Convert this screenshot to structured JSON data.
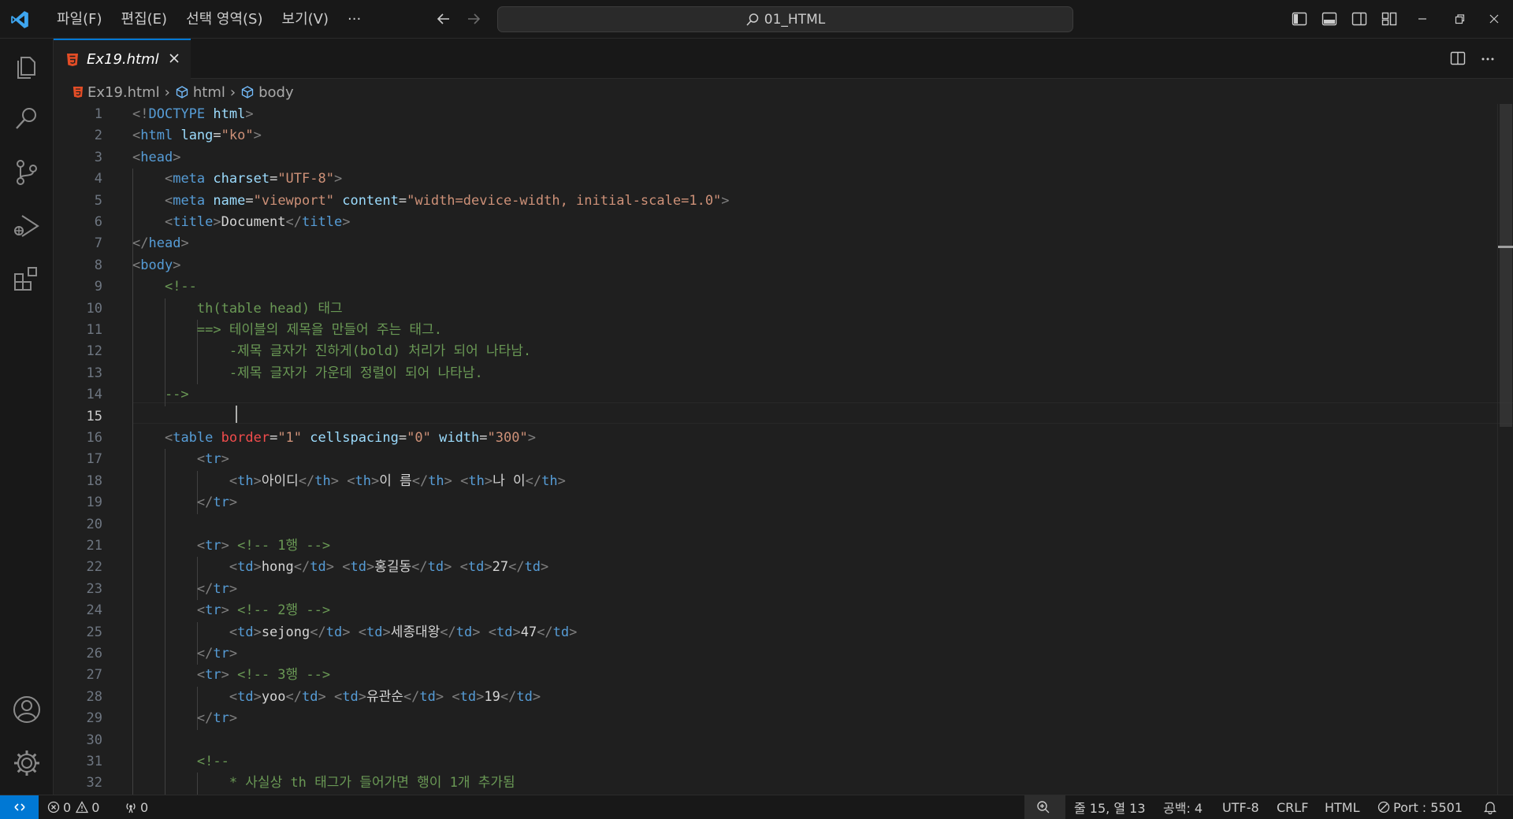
{
  "menus": [
    "파일(F)",
    "편집(E)",
    "선택 영역(S)",
    "보기(V)",
    "···"
  ],
  "command_center": {
    "label": "01_HTML"
  },
  "tab": {
    "name": "Ex19.html"
  },
  "breadcrumb": {
    "file": "Ex19.html",
    "html": "html",
    "body": "body"
  },
  "editor": {
    "active_line": 15,
    "lines": [
      [
        [
          "pun",
          "<!"
        ],
        [
          "tag",
          "DOCTYPE"
        ],
        [
          "txt",
          " "
        ],
        [
          "attr",
          "html"
        ],
        [
          "pun",
          ">"
        ]
      ],
      [
        [
          "pun",
          "<"
        ],
        [
          "tag",
          "html"
        ],
        [
          "txt",
          " "
        ],
        [
          "attr",
          "lang"
        ],
        [
          "txt",
          "="
        ],
        [
          "str",
          "\"ko\""
        ],
        [
          "pun",
          ">"
        ]
      ],
      [
        [
          "pun",
          "<"
        ],
        [
          "tag",
          "head"
        ],
        [
          "pun",
          ">"
        ]
      ],
      [
        [
          "txt",
          "    "
        ],
        [
          "pun",
          "<"
        ],
        [
          "tag",
          "meta"
        ],
        [
          "txt",
          " "
        ],
        [
          "attr",
          "charset"
        ],
        [
          "txt",
          "="
        ],
        [
          "str",
          "\"UTF-8\""
        ],
        [
          "pun",
          ">"
        ]
      ],
      [
        [
          "txt",
          "    "
        ],
        [
          "pun",
          "<"
        ],
        [
          "tag",
          "meta"
        ],
        [
          "txt",
          " "
        ],
        [
          "attr",
          "name"
        ],
        [
          "txt",
          "="
        ],
        [
          "str",
          "\"viewport\""
        ],
        [
          "txt",
          " "
        ],
        [
          "attr",
          "content"
        ],
        [
          "txt",
          "="
        ],
        [
          "str",
          "\"width=device-width, initial-scale=1.0\""
        ],
        [
          "pun",
          ">"
        ]
      ],
      [
        [
          "txt",
          "    "
        ],
        [
          "pun",
          "<"
        ],
        [
          "tag",
          "title"
        ],
        [
          "pun",
          ">"
        ],
        [
          "txt",
          "Document"
        ],
        [
          "pun",
          "</"
        ],
        [
          "tag",
          "title"
        ],
        [
          "pun",
          ">"
        ]
      ],
      [
        [
          "pun",
          "</"
        ],
        [
          "tag",
          "head"
        ],
        [
          "pun",
          ">"
        ]
      ],
      [
        [
          "pun",
          "<"
        ],
        [
          "tag",
          "body"
        ],
        [
          "pun",
          ">"
        ]
      ],
      [
        [
          "txt",
          "    "
        ],
        [
          "com",
          "<!--"
        ]
      ],
      [
        [
          "com",
          "        th(table head) 태그"
        ]
      ],
      [
        [
          "com",
          "        ==> 테이블의 제목을 만들어 주는 태그."
        ]
      ],
      [
        [
          "com",
          "            -제목 글자가 진하게(bold) 처리가 되어 나타남."
        ]
      ],
      [
        [
          "com",
          "            -제목 글자가 가운데 정렬이 되어 나타남."
        ]
      ],
      [
        [
          "com",
          "    -->"
        ]
      ],
      [],
      [
        [
          "txt",
          "    "
        ],
        [
          "pun",
          "<"
        ],
        [
          "tag",
          "table"
        ],
        [
          "txt",
          " "
        ],
        [
          "red",
          "border"
        ],
        [
          "txt",
          "="
        ],
        [
          "str",
          "\"1\""
        ],
        [
          "txt",
          " "
        ],
        [
          "attr",
          "cellspacing"
        ],
        [
          "txt",
          "="
        ],
        [
          "str",
          "\"0\""
        ],
        [
          "txt",
          " "
        ],
        [
          "attr",
          "width"
        ],
        [
          "txt",
          "="
        ],
        [
          "str",
          "\"300\""
        ],
        [
          "pun",
          ">"
        ]
      ],
      [
        [
          "txt",
          "        "
        ],
        [
          "pun",
          "<"
        ],
        [
          "tag",
          "tr"
        ],
        [
          "pun",
          ">"
        ]
      ],
      [
        [
          "txt",
          "            "
        ],
        [
          "pun",
          "<"
        ],
        [
          "tag",
          "th"
        ],
        [
          "pun",
          ">"
        ],
        [
          "txt",
          "아이디"
        ],
        [
          "pun",
          "</"
        ],
        [
          "tag",
          "th"
        ],
        [
          "pun",
          ">"
        ],
        [
          "txt",
          " "
        ],
        [
          "pun",
          "<"
        ],
        [
          "tag",
          "th"
        ],
        [
          "pun",
          ">"
        ],
        [
          "txt",
          "이 름"
        ],
        [
          "pun",
          "</"
        ],
        [
          "tag",
          "th"
        ],
        [
          "pun",
          ">"
        ],
        [
          "txt",
          " "
        ],
        [
          "pun",
          "<"
        ],
        [
          "tag",
          "th"
        ],
        [
          "pun",
          ">"
        ],
        [
          "txt",
          "나 이"
        ],
        [
          "pun",
          "</"
        ],
        [
          "tag",
          "th"
        ],
        [
          "pun",
          ">"
        ]
      ],
      [
        [
          "txt",
          "        "
        ],
        [
          "pun",
          "</"
        ],
        [
          "tag",
          "tr"
        ],
        [
          "pun",
          ">"
        ]
      ],
      [],
      [
        [
          "txt",
          "        "
        ],
        [
          "pun",
          "<"
        ],
        [
          "tag",
          "tr"
        ],
        [
          "pun",
          ">"
        ],
        [
          "txt",
          " "
        ],
        [
          "com",
          "<!-- 1행 -->"
        ]
      ],
      [
        [
          "txt",
          "            "
        ],
        [
          "pun",
          "<"
        ],
        [
          "tag",
          "td"
        ],
        [
          "pun",
          ">"
        ],
        [
          "txt",
          "hong"
        ],
        [
          "pun",
          "</"
        ],
        [
          "tag",
          "td"
        ],
        [
          "pun",
          ">"
        ],
        [
          "txt",
          " "
        ],
        [
          "pun",
          "<"
        ],
        [
          "tag",
          "td"
        ],
        [
          "pun",
          ">"
        ],
        [
          "txt",
          "홍길동"
        ],
        [
          "pun",
          "</"
        ],
        [
          "tag",
          "td"
        ],
        [
          "pun",
          ">"
        ],
        [
          "txt",
          " "
        ],
        [
          "pun",
          "<"
        ],
        [
          "tag",
          "td"
        ],
        [
          "pun",
          ">"
        ],
        [
          "txt",
          "27"
        ],
        [
          "pun",
          "</"
        ],
        [
          "tag",
          "td"
        ],
        [
          "pun",
          ">"
        ]
      ],
      [
        [
          "txt",
          "        "
        ],
        [
          "pun",
          "</"
        ],
        [
          "tag",
          "tr"
        ],
        [
          "pun",
          ">"
        ]
      ],
      [
        [
          "txt",
          "        "
        ],
        [
          "pun",
          "<"
        ],
        [
          "tag",
          "tr"
        ],
        [
          "pun",
          ">"
        ],
        [
          "txt",
          " "
        ],
        [
          "com",
          "<!-- 2행 -->"
        ]
      ],
      [
        [
          "txt",
          "            "
        ],
        [
          "pun",
          "<"
        ],
        [
          "tag",
          "td"
        ],
        [
          "pun",
          ">"
        ],
        [
          "txt",
          "sejong"
        ],
        [
          "pun",
          "</"
        ],
        [
          "tag",
          "td"
        ],
        [
          "pun",
          ">"
        ],
        [
          "txt",
          " "
        ],
        [
          "pun",
          "<"
        ],
        [
          "tag",
          "td"
        ],
        [
          "pun",
          ">"
        ],
        [
          "txt",
          "세종대왕"
        ],
        [
          "pun",
          "</"
        ],
        [
          "tag",
          "td"
        ],
        [
          "pun",
          ">"
        ],
        [
          "txt",
          " "
        ],
        [
          "pun",
          "<"
        ],
        [
          "tag",
          "td"
        ],
        [
          "pun",
          ">"
        ],
        [
          "txt",
          "47"
        ],
        [
          "pun",
          "</"
        ],
        [
          "tag",
          "td"
        ],
        [
          "pun",
          ">"
        ]
      ],
      [
        [
          "txt",
          "        "
        ],
        [
          "pun",
          "</"
        ],
        [
          "tag",
          "tr"
        ],
        [
          "pun",
          ">"
        ]
      ],
      [
        [
          "txt",
          "        "
        ],
        [
          "pun",
          "<"
        ],
        [
          "tag",
          "tr"
        ],
        [
          "pun",
          ">"
        ],
        [
          "txt",
          " "
        ],
        [
          "com",
          "<!-- 3행 -->"
        ]
      ],
      [
        [
          "txt",
          "            "
        ],
        [
          "pun",
          "<"
        ],
        [
          "tag",
          "td"
        ],
        [
          "pun",
          ">"
        ],
        [
          "txt",
          "yoo"
        ],
        [
          "pun",
          "</"
        ],
        [
          "tag",
          "td"
        ],
        [
          "pun",
          ">"
        ],
        [
          "txt",
          " "
        ],
        [
          "pun",
          "<"
        ],
        [
          "tag",
          "td"
        ],
        [
          "pun",
          ">"
        ],
        [
          "txt",
          "유관순"
        ],
        [
          "pun",
          "</"
        ],
        [
          "tag",
          "td"
        ],
        [
          "pun",
          ">"
        ],
        [
          "txt",
          " "
        ],
        [
          "pun",
          "<"
        ],
        [
          "tag",
          "td"
        ],
        [
          "pun",
          ">"
        ],
        [
          "txt",
          "19"
        ],
        [
          "pun",
          "</"
        ],
        [
          "tag",
          "td"
        ],
        [
          "pun",
          ">"
        ]
      ],
      [
        [
          "txt",
          "        "
        ],
        [
          "pun",
          "</"
        ],
        [
          "tag",
          "tr"
        ],
        [
          "pun",
          ">"
        ]
      ],
      [],
      [
        [
          "txt",
          "        "
        ],
        [
          "com",
          "<!--"
        ]
      ],
      [
        [
          "com",
          "            * 사실상 th 태그가 들어가면 행이 1개 추가됨"
        ]
      ]
    ]
  },
  "statusbar": {
    "errors": "0",
    "warnings": "0",
    "ports": "0",
    "position": "줄 15, 열 13",
    "indent": "공백: 4",
    "encoding": "UTF-8",
    "eol": "CRLF",
    "language": "HTML",
    "port": "Port : 5501"
  },
  "colors": {
    "accent": "#0078d4",
    "html_icon": "#e44d26",
    "tag": "#569cd6",
    "attr": "#9cdcfe",
    "string": "#ce9178",
    "comment": "#6a9955"
  }
}
